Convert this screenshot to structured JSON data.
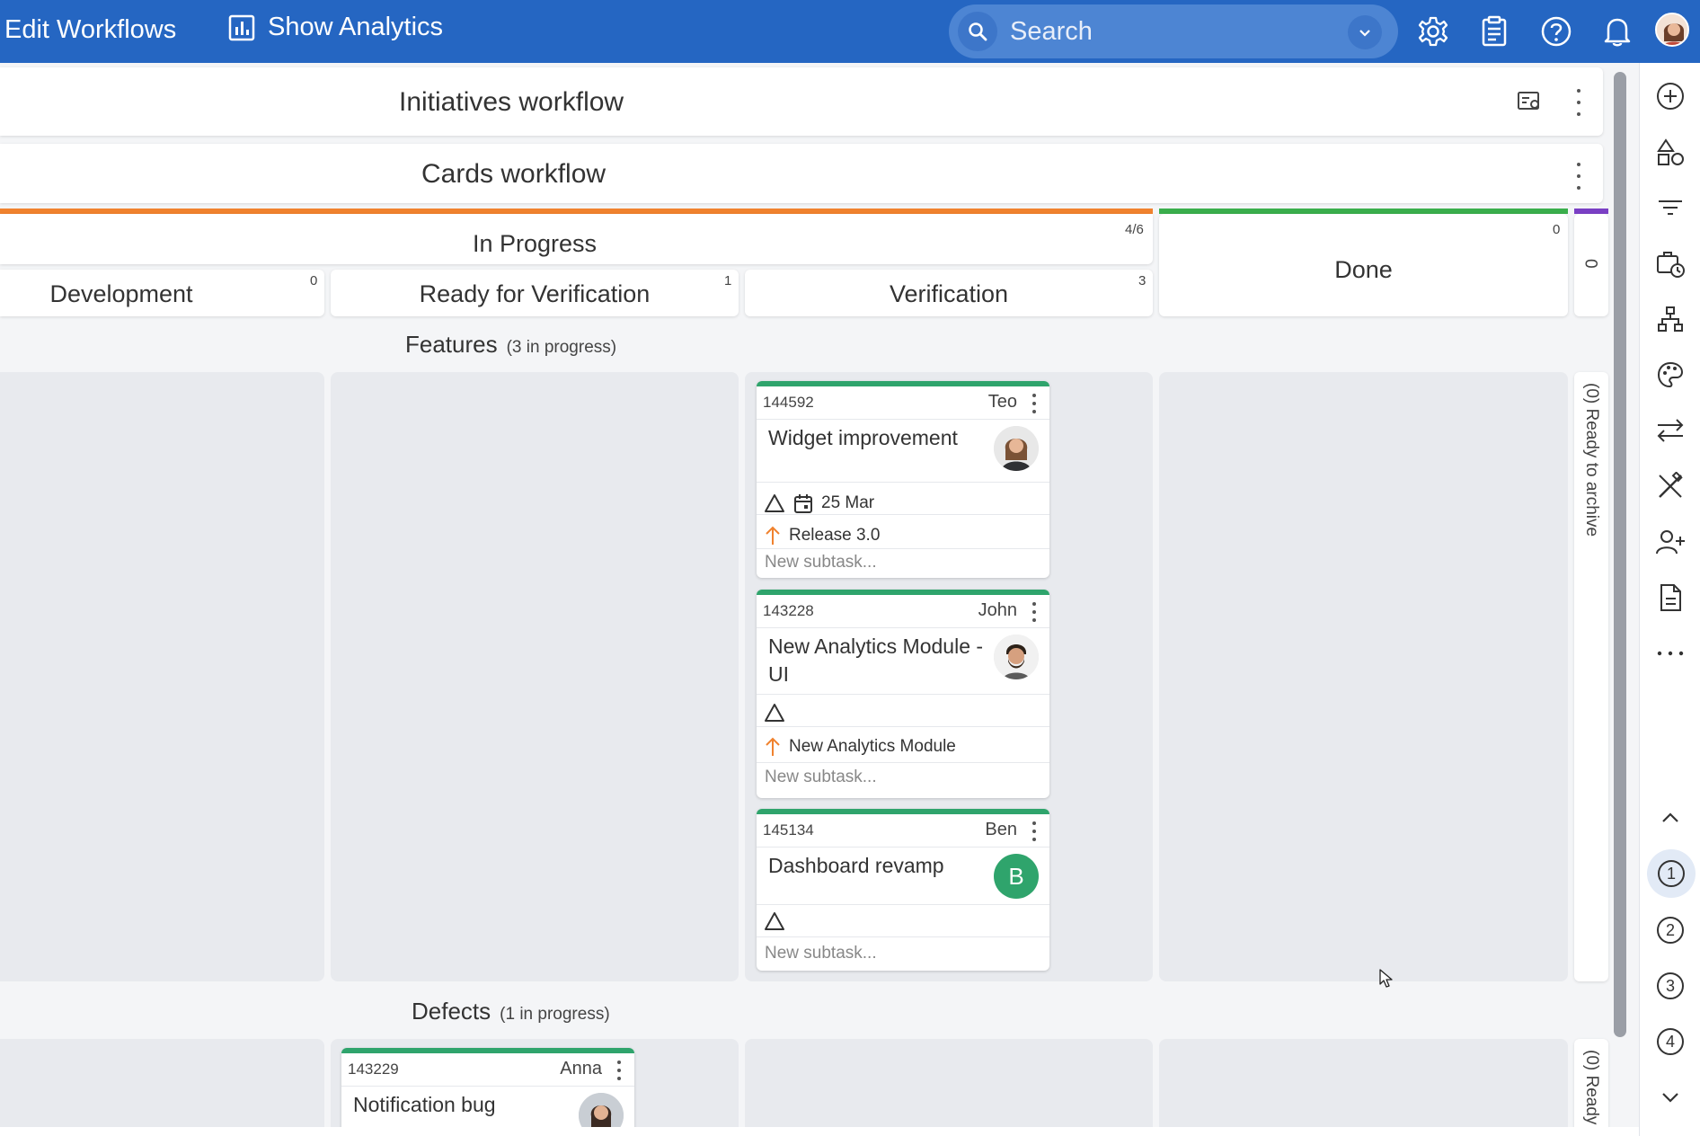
{
  "topbar": {
    "edit_label": "Edit Workflows",
    "analytics_label": "Show Analytics",
    "search_placeholder": "Search"
  },
  "rows": {
    "initiatives_title": "Initiatives workflow",
    "cards_title": "Cards workflow"
  },
  "lanes": {
    "in_progress": {
      "label": "In Progress",
      "count": "4/6"
    },
    "done": {
      "label": "Done",
      "count": "0"
    },
    "archive_count": "0",
    "columns": [
      {
        "label": "Development",
        "count": "0"
      },
      {
        "label": "Ready for Verification",
        "count": "1"
      },
      {
        "label": "Verification",
        "count": "3"
      }
    ]
  },
  "sections": {
    "features": {
      "title": "Features",
      "subtitle": "(3 in progress)"
    },
    "defects": {
      "title": "Defects",
      "subtitle": "(1 in progress)"
    },
    "archive_label_features": "(0) Ready to archive",
    "archive_label_defects": "(0) Ready"
  },
  "cards": [
    {
      "id": "144592",
      "owner": "Teo",
      "title": "Widget improvement",
      "date": "25 Mar",
      "parent": "Release 3.0",
      "subtask_placeholder": "New subtask..."
    },
    {
      "id": "143228",
      "owner": "John",
      "title": "New Analytics Module - UI",
      "parent": "New Analytics Module",
      "subtask_placeholder": "New subtask..."
    },
    {
      "id": "145134",
      "owner": "Ben",
      "title": "Dashboard revamp",
      "avatar_letter": "B",
      "subtask_placeholder": "New subtask..."
    },
    {
      "id": "143229",
      "owner": "Anna",
      "title": "Notification bug"
    }
  ],
  "sidebar_levels": [
    "1",
    "2",
    "3",
    "4"
  ],
  "colors": {
    "topbar": "#2566c2",
    "in_progress_bar": "#f0822e",
    "done_bar": "#3aae4c",
    "archive_bar": "#7a3fc4",
    "card_accent": "#2fa46c",
    "avatar_ben": "#2fa46c"
  }
}
